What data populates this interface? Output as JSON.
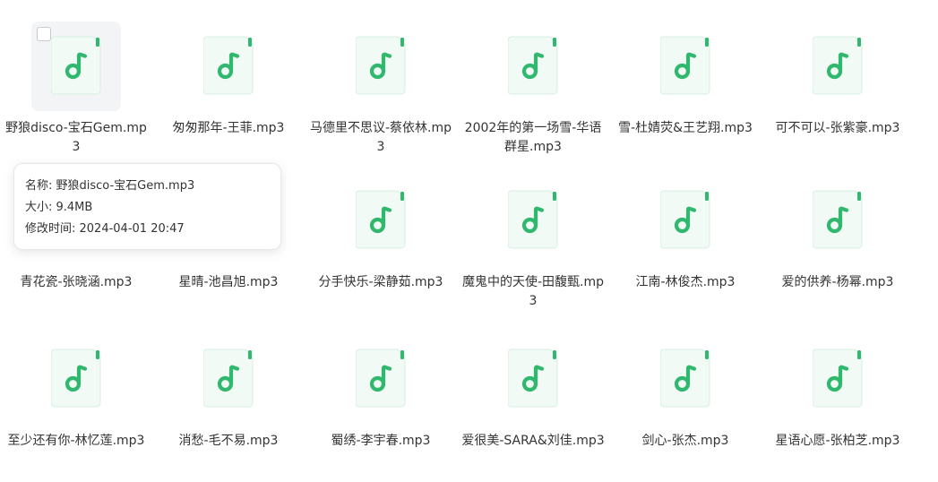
{
  "accent_color": "#2fb86e",
  "file_icon": "music-file-icon",
  "files": [
    {
      "name": "野狼disco-宝石Gem.mp3",
      "hover": true
    },
    {
      "name": "匆匆那年-王菲.mp3"
    },
    {
      "name": "马德里不思议-蔡依林.mp3"
    },
    {
      "name": "2002年的第一场雪-华语群星.mp3"
    },
    {
      "name": "雪-杜婧荧&王艺翔.mp3"
    },
    {
      "name": "可不可以-张紫豪.mp3"
    },
    {
      "name": "青花瓷-张晓涵.mp3"
    },
    {
      "name": "星晴-池昌旭.mp3"
    },
    {
      "name": "分手快乐-梁静茹.mp3"
    },
    {
      "name": "魔鬼中的天使-田馥甄.mp3"
    },
    {
      "name": "江南-林俊杰.mp3"
    },
    {
      "name": "爱的供养-杨幂.mp3"
    },
    {
      "name": "至少还有你-林忆莲.mp3"
    },
    {
      "name": "消愁-毛不易.mp3"
    },
    {
      "name": "蜀绣-李宇春.mp3"
    },
    {
      "name": "爱很美-SARA&刘佳.mp3"
    },
    {
      "name": "剑心-张杰.mp3"
    },
    {
      "name": "星语心愿-张柏芝.mp3"
    }
  ],
  "tooltip": {
    "name_line": "名称: 野狼disco-宝石Gem.mp3",
    "size_line": "大小: 9.4MB",
    "modified_line": "修改时间: 2024-04-01 20:47"
  }
}
